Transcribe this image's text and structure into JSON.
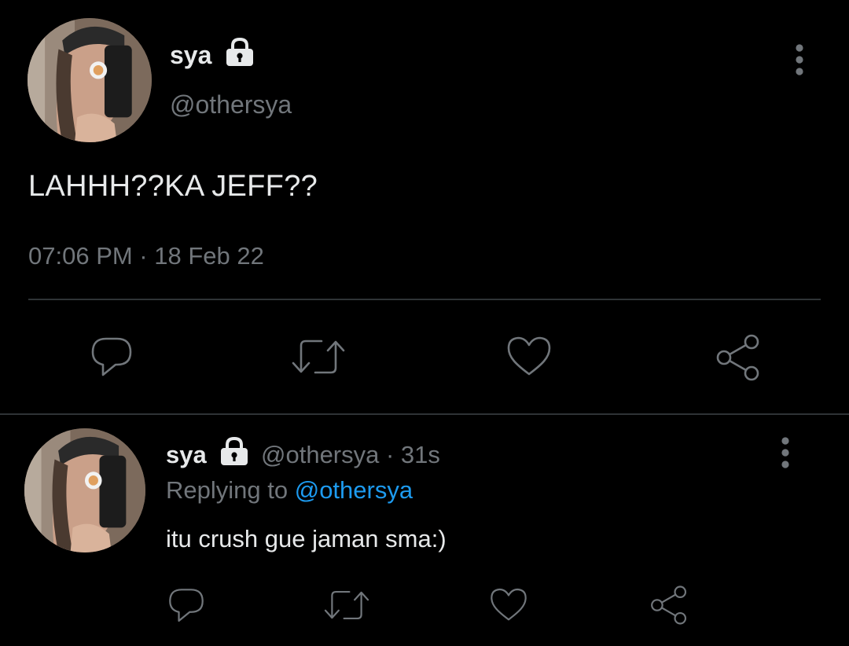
{
  "main_tweet": {
    "display_name": "sya",
    "handle": "@othersya",
    "text": "LAHHH??KA JEFF??",
    "timestamp": "07:06 PM · 18 Feb 22",
    "protected_icon": "lock-icon",
    "actions": [
      "reply-icon",
      "retweet-icon",
      "like-icon",
      "share-icon"
    ]
  },
  "reply_tweet": {
    "display_name": "sya",
    "handle_time": "@othersya · 31s",
    "replying_prefix": "Replying to ",
    "replying_to": "@othersya",
    "text": "itu crush gue jaman sma:)",
    "protected_icon": "lock-icon",
    "actions": [
      "reply-icon",
      "retweet-icon",
      "like-icon",
      "share-icon"
    ]
  },
  "colors": {
    "background": "#000000",
    "primary_text": "#e7e9ea",
    "secondary_text": "#71767b",
    "link": "#1d9bf0",
    "divider": "#2f3336"
  }
}
